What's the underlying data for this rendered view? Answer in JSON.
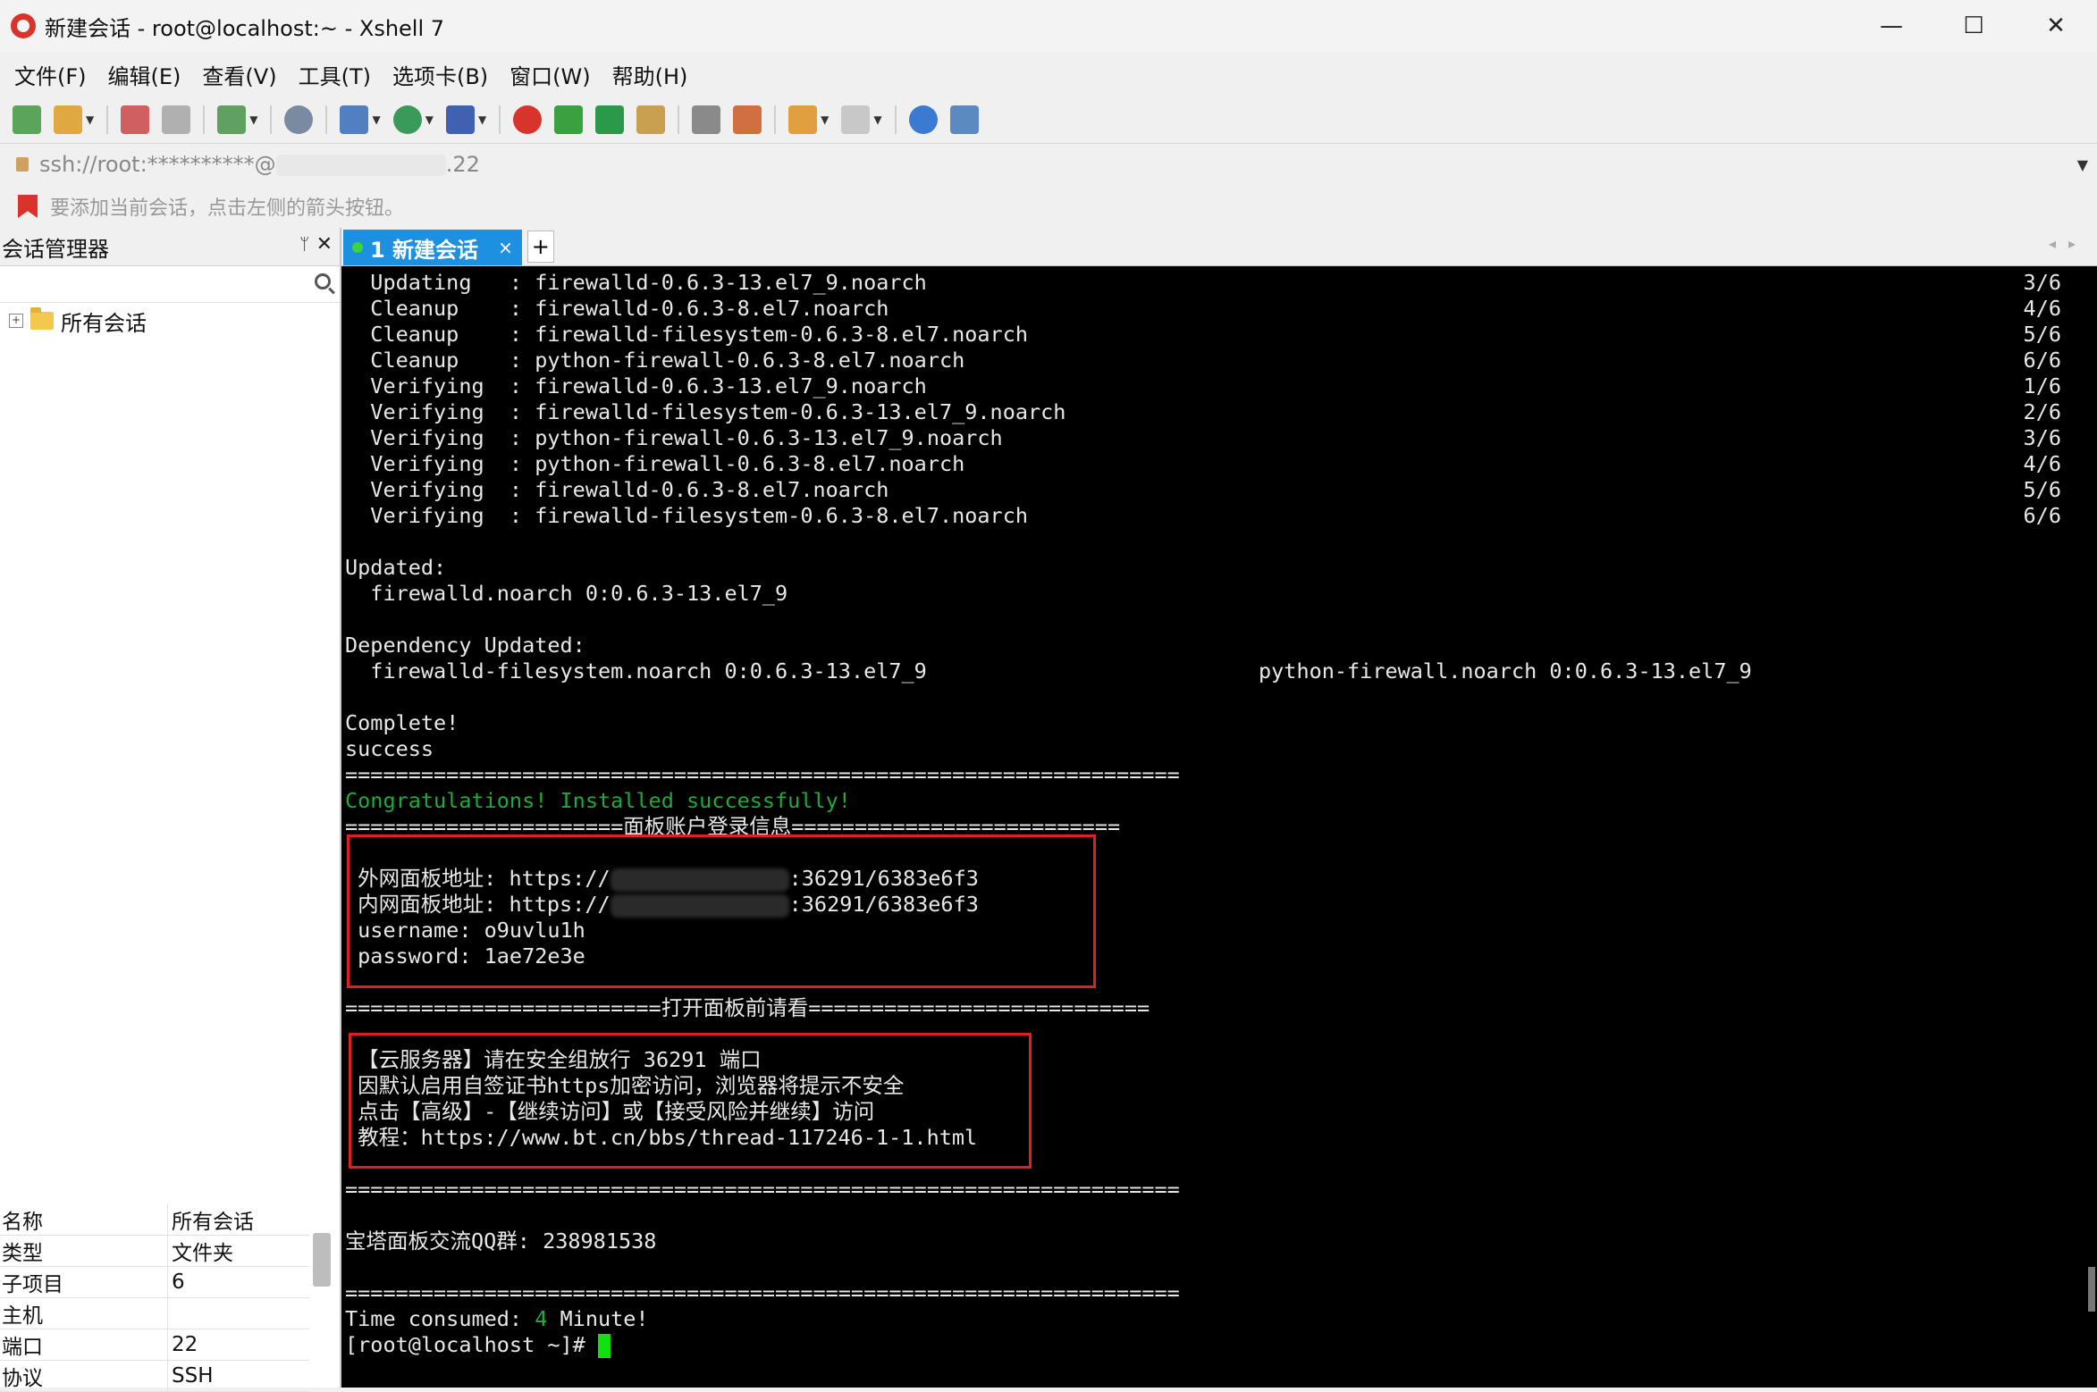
{
  "window": {
    "title": "新建会话 - root@localhost:~ - Xshell 7",
    "minimize": "—",
    "maximize": "☐",
    "close": "✕"
  },
  "menu": [
    "文件(F)",
    "编辑(E)",
    "查看(V)",
    "工具(T)",
    "选项卡(B)",
    "窗口(W)",
    "帮助(H)"
  ],
  "address": {
    "text_prefix": "ssh://root:**********@",
    "text_suffix": ".22"
  },
  "hint": "要添加当前会话，点击左侧的箭头按钮。",
  "sidebar": {
    "title": "会话管理器",
    "pin": "ᛘ",
    "close": "✕",
    "tree_root": "所有会话",
    "props": [
      {
        "key": "名称",
        "value": "所有会话"
      },
      {
        "key": "类型",
        "value": "文件夹"
      },
      {
        "key": "子项目",
        "value": "6"
      },
      {
        "key": "主机",
        "value": ""
      },
      {
        "key": "端口",
        "value": "22"
      },
      {
        "key": "协议",
        "value": "SSH"
      }
    ]
  },
  "tab": {
    "label": "1 新建会话",
    "close": "×",
    "add": "+"
  },
  "terminal": {
    "lines": [
      {
        "text": "  Updating   : firewalld-0.6.3-13.el7_9.noarch",
        "count": "3/6"
      },
      {
        "text": "  Cleanup    : firewalld-0.6.3-8.el7.noarch",
        "count": "4/6"
      },
      {
        "text": "  Cleanup    : firewalld-filesystem-0.6.3-8.el7.noarch",
        "count": "5/6"
      },
      {
        "text": "  Cleanup    : python-firewall-0.6.3-8.el7.noarch",
        "count": "6/6"
      },
      {
        "text": "  Verifying  : firewalld-0.6.3-13.el7_9.noarch",
        "count": "1/6"
      },
      {
        "text": "  Verifying  : firewalld-filesystem-0.6.3-13.el7_9.noarch",
        "count": "2/6"
      },
      {
        "text": "  Verifying  : python-firewall-0.6.3-13.el7_9.noarch",
        "count": "3/6"
      },
      {
        "text": "  Verifying  : python-firewall-0.6.3-8.el7.noarch",
        "count": "4/6"
      },
      {
        "text": "  Verifying  : firewalld-0.6.3-8.el7.noarch",
        "count": "5/6"
      },
      {
        "text": "  Verifying  : firewalld-filesystem-0.6.3-8.el7.noarch",
        "count": "6/6"
      }
    ],
    "updated_header": "Updated:",
    "updated_pkg": "  firewalld.noarch 0:0.6.3-13.el7_9",
    "dep_header": "Dependency Updated:",
    "dep_pkg1": "  firewalld-filesystem.noarch 0:0.6.3-13.el7_9",
    "dep_pkg2": "python-firewall.noarch 0:0.6.3-13.el7_9",
    "complete": "Complete!",
    "success": "success",
    "separator": "==================================================================",
    "congrats": "Congratulations! Installed successfully!",
    "login_sep": "======================面板账户登录信息==========================",
    "outer_prefix": " 外网面板地址: https://",
    "outer_suffix": ":36291/6383e6f3",
    "inner_prefix": " 内网面板地址: https://",
    "inner_suffix": ":36291/6383e6f3",
    "username": " username: o9uvlu1h",
    "password": " password: 1ae72e3e",
    "open_sep": "=========================打开面板前请看===========================",
    "note1": " 【云服务器】请在安全组放行 36291 端口",
    "note2": " 因默认启用自签证书https加密访问，浏览器将提示不安全",
    "note3": " 点击【高级】-【继续访问】或【接受风险并继续】访问",
    "note4": " 教程：https://www.bt.cn/bbs/thread-117246-1-1.html",
    "qq": "宝塔面板交流QQ群: 238981538",
    "time_prefix": "Time consumed: ",
    "time_value": "4",
    "time_suffix": " Minute!",
    "prompt": "[root@localhost ~]# "
  },
  "colors": {
    "accent": "#1e90e0",
    "terminal_bg": "#000000",
    "terminal_fg": "#e8e8e8",
    "terminal_green": "#1faa3b",
    "highlight_box": "#e02020",
    "cursor": "#10e010"
  }
}
